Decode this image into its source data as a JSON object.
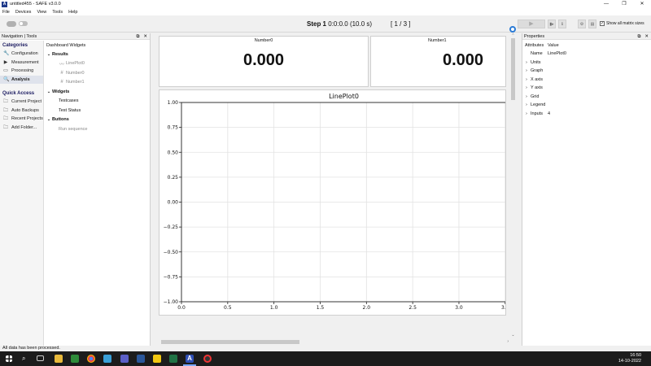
{
  "window": {
    "title": "untitled455 - SAFE v3.0.0",
    "app_icon": "A",
    "minimize": "—",
    "restore": "❐",
    "close": "✕"
  },
  "menu": [
    "File",
    "Devices",
    "View",
    "Tools",
    "Help"
  ],
  "toolbar": {
    "step_label": "Step 1",
    "step_time": "0:0:0.0 (10.0 s)",
    "counter": "[ 1 / 3 ]",
    "show_all_matrix_sizes": "Show all matrix sizes",
    "show_all_checked": true
  },
  "nav": {
    "header": "Navigation | Tools",
    "categories_title": "Categories",
    "categories": [
      "Configuration",
      "Measurement",
      "Processing",
      "Analysis"
    ],
    "selected_category": "Analysis",
    "quick_access_title": "Quick Access",
    "quick_access": [
      "Current Project",
      "Auto Backups",
      "Recent Projects",
      "Add Folder..."
    ],
    "tree_header": "Dashboard Widgets",
    "tree": [
      {
        "label": "Results",
        "children": [
          "LinePlot0",
          "Number0",
          "Number1"
        ]
      },
      {
        "label": "Widgets",
        "children": [
          "Testcases",
          "Test Status"
        ]
      },
      {
        "label": "Buttons",
        "children": [
          "Run sequence"
        ]
      }
    ]
  },
  "dashboard": {
    "number0": {
      "name": "Number0",
      "value": "0.000"
    },
    "number1": {
      "name": "Number1",
      "value": "0.000"
    }
  },
  "chart_data": {
    "type": "line",
    "title": "LinePlot0",
    "xlabel": "",
    "ylabel": "",
    "xlim": [
      0.0,
      3.5
    ],
    "ylim": [
      -1.0,
      1.0
    ],
    "x_ticks": [
      "0.0",
      "0.5",
      "1.0",
      "1.5",
      "2.0",
      "2.5",
      "3.0",
      "3.5"
    ],
    "y_ticks": [
      "1.00",
      "0.75",
      "0.50",
      "0.25",
      "0.00",
      "−0.25",
      "−0.50",
      "−0.75",
      "−1.00"
    ],
    "grid": true,
    "series": []
  },
  "properties": {
    "header": "Properties",
    "col_attr": "Attributes",
    "col_value": "Value",
    "rows": [
      {
        "key": "Name",
        "value": "LinePlot0",
        "expandable": false
      },
      {
        "key": "Units",
        "value": "",
        "expandable": true
      },
      {
        "key": "Graph",
        "value": "",
        "expandable": true
      },
      {
        "key": "X axis",
        "value": "",
        "expandable": true
      },
      {
        "key": "Y axis",
        "value": "",
        "expandable": true
      },
      {
        "key": "Grid",
        "value": "",
        "expandable": true
      },
      {
        "key": "Legend",
        "value": "",
        "expandable": true
      },
      {
        "key": "Inputs",
        "value": "4",
        "expandable": true
      }
    ]
  },
  "status": "All data has been processed.",
  "taskbar": {
    "time": "16:50",
    "date": "14-10-2022"
  }
}
